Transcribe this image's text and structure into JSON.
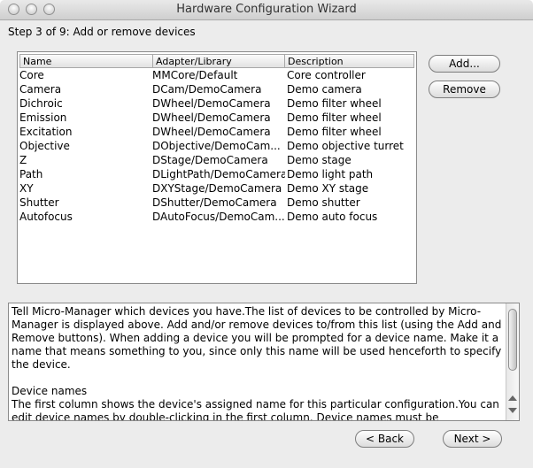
{
  "window": {
    "title": "Hardware Configuration Wizard"
  },
  "step_label": "Step 3 of 9: Add or remove devices",
  "table": {
    "columns": [
      "Name",
      "Adapter/Library",
      "Description"
    ],
    "rows": [
      {
        "name": "Core",
        "adapter": "MMCore/Default",
        "description": "Core controller"
      },
      {
        "name": "Camera",
        "adapter": "DCam/DemoCamera",
        "description": "Demo camera"
      },
      {
        "name": "Dichroic",
        "adapter": "DWheel/DemoCamera",
        "description": "Demo filter wheel"
      },
      {
        "name": "Emission",
        "adapter": "DWheel/DemoCamera",
        "description": "Demo filter wheel"
      },
      {
        "name": "Excitation",
        "adapter": "DWheel/DemoCamera",
        "description": "Demo filter wheel"
      },
      {
        "name": "Objective",
        "adapter": "DObjective/DemoCam...",
        "description": "Demo objective turret"
      },
      {
        "name": "Z",
        "adapter": "DStage/DemoCamera",
        "description": "Demo stage"
      },
      {
        "name": "Path",
        "adapter": "DLightPath/DemoCamera",
        "description": "Demo light path"
      },
      {
        "name": "XY",
        "adapter": "DXYStage/DemoCamera",
        "description": "Demo XY stage"
      },
      {
        "name": "Shutter",
        "adapter": "DShutter/DemoCamera",
        "description": "Demo shutter"
      },
      {
        "name": "Autofocus",
        "adapter": "DAutoFocus/DemoCam...",
        "description": "Demo auto focus"
      }
    ]
  },
  "buttons": {
    "add": "Add...",
    "remove": "Remove",
    "back": "< Back",
    "next": "Next >"
  },
  "help": {
    "paragraph1": "Tell Micro-Manager which devices you have.The list of devices to be controlled by Micro-Manager is displayed above. Add and/or remove devices to/from this list (using the Add and Remove buttons). When adding a device you will be prompted for a device name. Make it a name that means something to you, since only this name will be used henceforth to specify the device.",
    "heading": "Device names",
    "paragraph2": "The first column shows the device's assigned name for this particular configuration.You can edit device names by double-clicking in the first column. Device names must be"
  }
}
